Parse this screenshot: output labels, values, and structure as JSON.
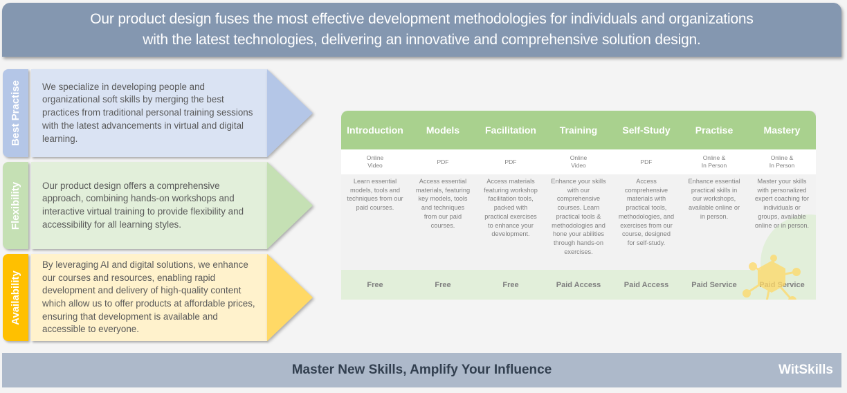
{
  "banner": {
    "line1": "Our product design fuses the most effective development methodologies for individuals and organizations",
    "line2": "with the latest technologies, delivering an innovative and comprehensive solution design."
  },
  "pillars": [
    {
      "label": "Best Practise",
      "text": "We specialize in developing people and organizational soft skills by merging the best practices from traditional personal training sessions with the latest advancements in virtual and digital learning.",
      "tab_color": "#b4c6e7",
      "body_color": "#dae3f3",
      "tip_color": "#b4c6e7"
    },
    {
      "label": "Flexibility",
      "text": "Our product design offers a comprehensive approach, combining hands-on workshops and interactive virtual training to provide flexibility and accessibility for all learning styles.",
      "tab_color": "#c5e0b4",
      "body_color": "#e2efda",
      "tip_color": "#c5e0b4"
    },
    {
      "label": "Availability",
      "text": "By leveraging AI and digital solutions, we enhance our courses and resources, enabling rapid development and delivery of high-quality content which allow us to offer products at affordable prices, ensuring that development is available and accessible to everyone.",
      "tab_color": "#ffc000",
      "body_color": "#fff2cc",
      "tip_color": "#ffd966"
    }
  ],
  "table": {
    "header_color": "#a9d18e",
    "columns": [
      {
        "title": "Introduction",
        "format": "Online\nVideo",
        "description": "Learn essential models, tools and techniques from our paid courses.",
        "price": "Free"
      },
      {
        "title": "Models",
        "format": "PDF",
        "description": "Access essential materials, featuring key models, tools and techniques from our paid courses.",
        "price": "Free"
      },
      {
        "title": "Facilitation",
        "format": "PDF",
        "description": "Access materials featuring workshop facilitation tools, packed with practical exercises to enhance your development.",
        "price": "Free"
      },
      {
        "title": "Training",
        "format": "Online\nVideo",
        "description": "Enhance your skills with our comprehensive courses. Learn practical tools & methodologies and hone your abilities through hands-on exercises.",
        "price": "Paid Access"
      },
      {
        "title": "Self-Study",
        "format": "PDF",
        "description": "Access comprehensive materials with practical tools, methodologies, and exercises from our course, designed for self-study.",
        "price": "Paid Access"
      },
      {
        "title": "Practise",
        "format": "Online &\nIn Person",
        "description": "Enhance essential practical skills in our workshops, available online or in person.",
        "price": "Paid Service"
      },
      {
        "title": "Mastery",
        "format": "Online &\nIn Person",
        "description": "Master your skills with personalized expert coaching for individuals or groups, available online or in person.",
        "price": "Paid Service"
      }
    ]
  },
  "decorations": {
    "molecule_icon": "molecule-icon",
    "molecule_color": "#ffd966"
  },
  "footer": {
    "tagline": "Master New Skills, Amplify Your Influence",
    "brand": "WitSkills"
  }
}
